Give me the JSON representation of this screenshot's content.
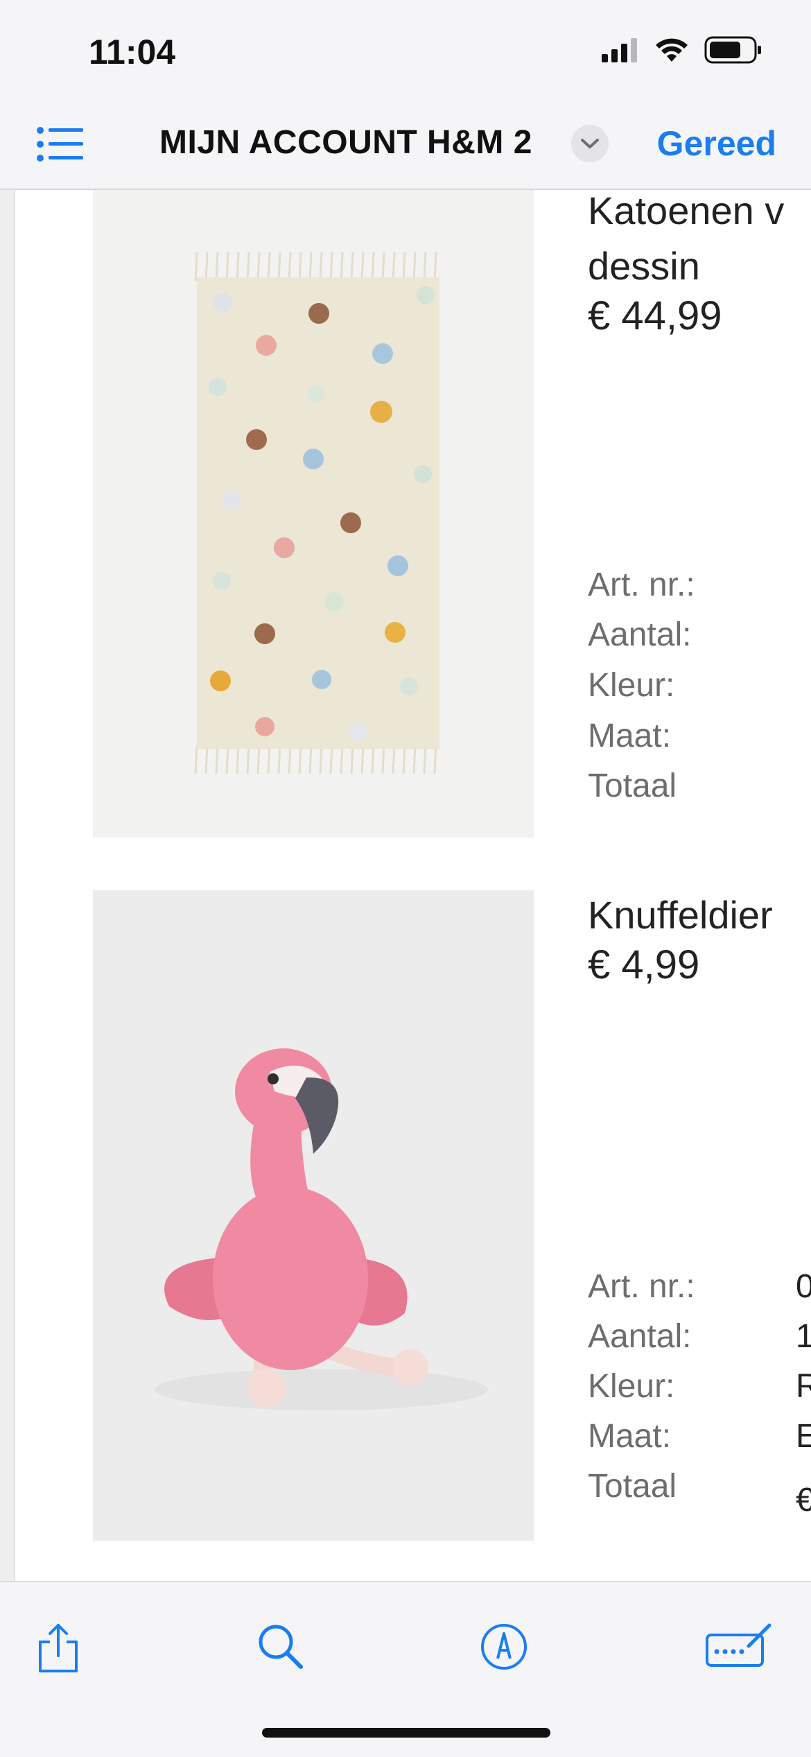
{
  "status_bar": {
    "time": "11:04",
    "icons": [
      "cellular-signal-icon",
      "wifi-icon",
      "battery-icon"
    ]
  },
  "nav": {
    "title": "MIJN ACCOUNT  H&M 2",
    "done_label": "Gereed",
    "accent_color": "#1a7df0"
  },
  "products": [
    {
      "name_lines": [
        "Katoenen v",
        "dessin"
      ],
      "price": "€ 44,99",
      "image": "rug-with-colored-dots",
      "labels": [
        "Art. nr.:",
        "Aantal:",
        "Kleur:",
        "Maat:",
        "Totaal"
      ],
      "values": [
        "",
        "",
        "",
        "",
        ""
      ]
    },
    {
      "name_lines": [
        "Knuffeldier"
      ],
      "price": "€ 4,99",
      "image": "pink-flamingo-plush",
      "labels": [
        "Art. nr.:",
        "Aantal:",
        "Kleur:",
        "Maat:",
        "Totaal"
      ],
      "values": [
        "0",
        "1",
        "R",
        "E",
        "€"
      ]
    }
  ],
  "toolbar": {
    "icons": [
      "share-icon",
      "search-icon",
      "markup-icon",
      "keyboard-edit-icon"
    ]
  }
}
